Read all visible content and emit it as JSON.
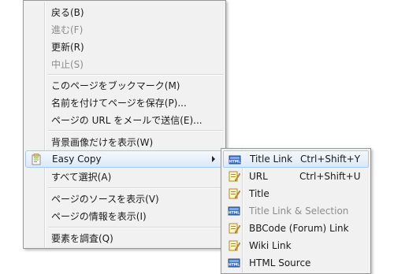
{
  "main_menu": {
    "items": [
      {
        "label": "戻る(B)"
      },
      {
        "label": "進む(F)"
      },
      {
        "label": "更新(R)"
      },
      {
        "label": "中止(S)"
      },
      {
        "label": "このページをブックマーク(M)"
      },
      {
        "label": "名前を付けてページを保存(P)..."
      },
      {
        "label": "ページの URL をメールで送信(E)..."
      },
      {
        "label": "背景画像だけを表示(W)"
      },
      {
        "label": "Easy Copy"
      },
      {
        "label": "すべて選択(A)"
      },
      {
        "label": "ページのソースを表示(V)"
      },
      {
        "label": "ページの情報を表示(I)"
      },
      {
        "label": "要素を調査(Q)"
      }
    ]
  },
  "sub_menu": {
    "items": [
      {
        "label": "Title Link",
        "shortcut": "Ctrl+Shift+Y",
        "icon": "html-icon"
      },
      {
        "label": "URL",
        "shortcut": "Ctrl+Shift+U",
        "icon": "notepad-icon"
      },
      {
        "label": "Title",
        "icon": "notepad-icon"
      },
      {
        "label": "Title Link & Selection",
        "icon": "html-icon"
      },
      {
        "label": "BBCode (Forum) Link",
        "icon": "notepad-icon"
      },
      {
        "label": "Wiki Link",
        "icon": "notepad-icon"
      },
      {
        "label": "HTML Source",
        "icon": "html-icon"
      }
    ]
  },
  "colors": {
    "menu_bg": "#f1f1f1",
    "highlight_border": "#a8c8ec",
    "disabled_text": "#8d8d8d"
  }
}
